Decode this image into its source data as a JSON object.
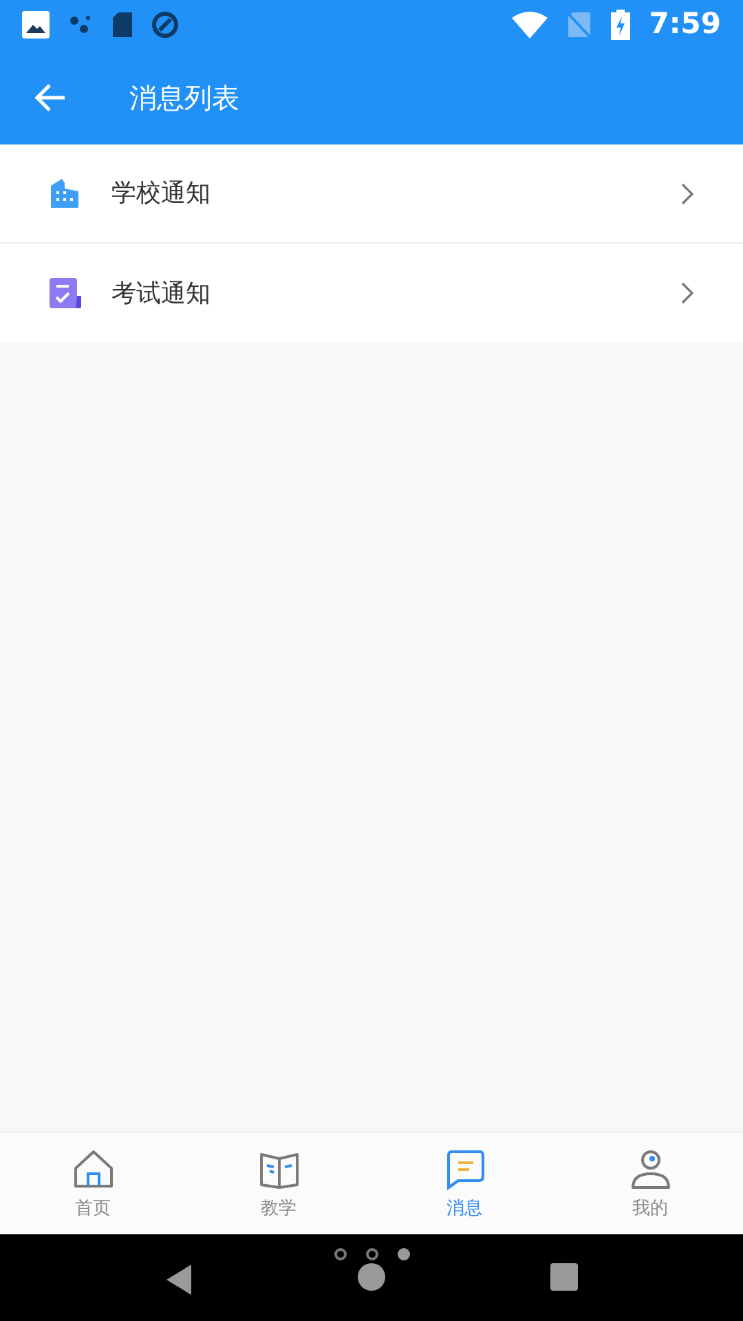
{
  "status_bar": {
    "time": "7:59"
  },
  "header": {
    "title": "消息列表"
  },
  "items": [
    {
      "label": "学校通知",
      "kind": "school"
    },
    {
      "label": "考试通知",
      "kind": "exam"
    }
  ],
  "tabs": [
    {
      "label": "首页",
      "kind": "home",
      "selected": false
    },
    {
      "label": "教学",
      "kind": "book",
      "selected": false
    },
    {
      "label": "消息",
      "kind": "message",
      "selected": true
    },
    {
      "label": "我的",
      "kind": "profile",
      "selected": false
    }
  ],
  "pager": [
    {
      "selected": false
    },
    {
      "selected": false
    },
    {
      "selected": true
    }
  ]
}
